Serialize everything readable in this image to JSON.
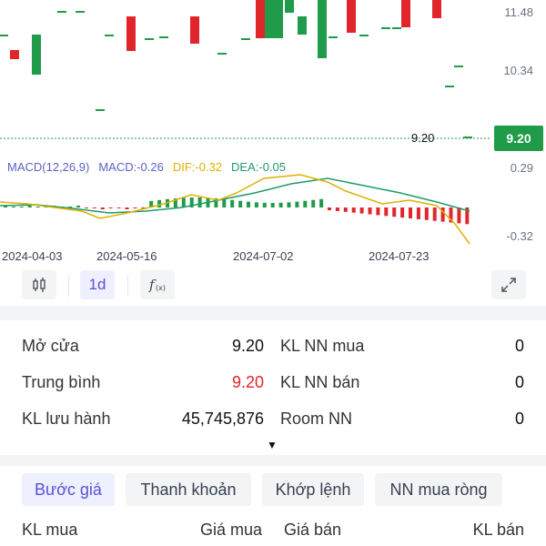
{
  "chart": {
    "price_axis": [
      "11.48",
      "10.34"
    ],
    "last_price": "9.20",
    "last_price_inline": "9.20",
    "macd_axis": [
      "0.29",
      "-0.32"
    ],
    "macd_legend": {
      "params": "MACD(12,26,9)",
      "macd": "MACD:-0.26",
      "dif": "DIF:-0.32",
      "dea": "DEA:-0.05"
    },
    "dates": [
      "2024-04-03",
      "2024-05-16",
      "2024-07-02",
      "2024-07-23"
    ],
    "colors": {
      "up": "#1f9b4a",
      "down": "#e0262b",
      "dif": "#e0b000",
      "dea": "#1f9b6a",
      "macd_label": "#5b5fc7"
    }
  },
  "toolbar": {
    "candle_icon": "candlestick-icon",
    "interval": "1d",
    "indicator_icon": "function-icon",
    "expand_icon": "expand-icon"
  },
  "info": {
    "rows": [
      {
        "left_label": "Mở cửa",
        "left_value": "9.20",
        "right_label": "KL NN mua",
        "right_value": "0"
      },
      {
        "left_label": "Trung bình",
        "left_value": "9.20",
        "right_label": "KL NN bán",
        "right_value": "0"
      },
      {
        "left_label": "KL lưu hành",
        "left_value": "45,745,876",
        "right_label": "Room NN",
        "right_value": "0"
      }
    ],
    "expand_caret": "▼"
  },
  "tabs": [
    {
      "label": "Bước giá"
    },
    {
      "label": "Thanh khoản"
    },
    {
      "label": "Khớp lệnh"
    },
    {
      "label": "NN mua ròng"
    }
  ],
  "table": {
    "headers": [
      "KL mua",
      "Giá mua",
      "Giá bán",
      "KL bán"
    ]
  }
}
